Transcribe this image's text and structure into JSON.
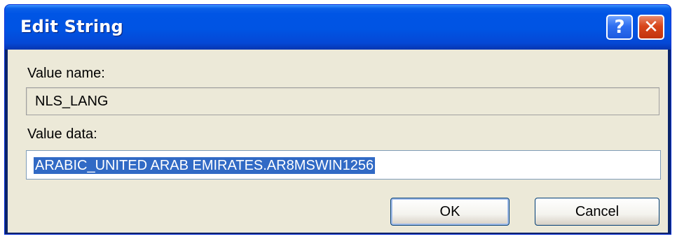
{
  "window": {
    "title": "Edit String",
    "help_glyph": "?",
    "close_glyph": "✕"
  },
  "fields": {
    "value_name_label": "Value name:",
    "value_name": "NLS_LANG",
    "value_data_label": "Value data:",
    "value_data": "ARABIC_UNITED ARAB EMIRATES.AR8MSWIN1256"
  },
  "buttons": {
    "ok_label": "OK",
    "cancel_label": "Cancel"
  },
  "icons": [
    "help-icon",
    "close-icon"
  ],
  "colors": {
    "titlebar": "#0054e3",
    "dialog_bg": "#ece9d8",
    "selection": "#316ac5",
    "close_button": "#d8461b"
  }
}
